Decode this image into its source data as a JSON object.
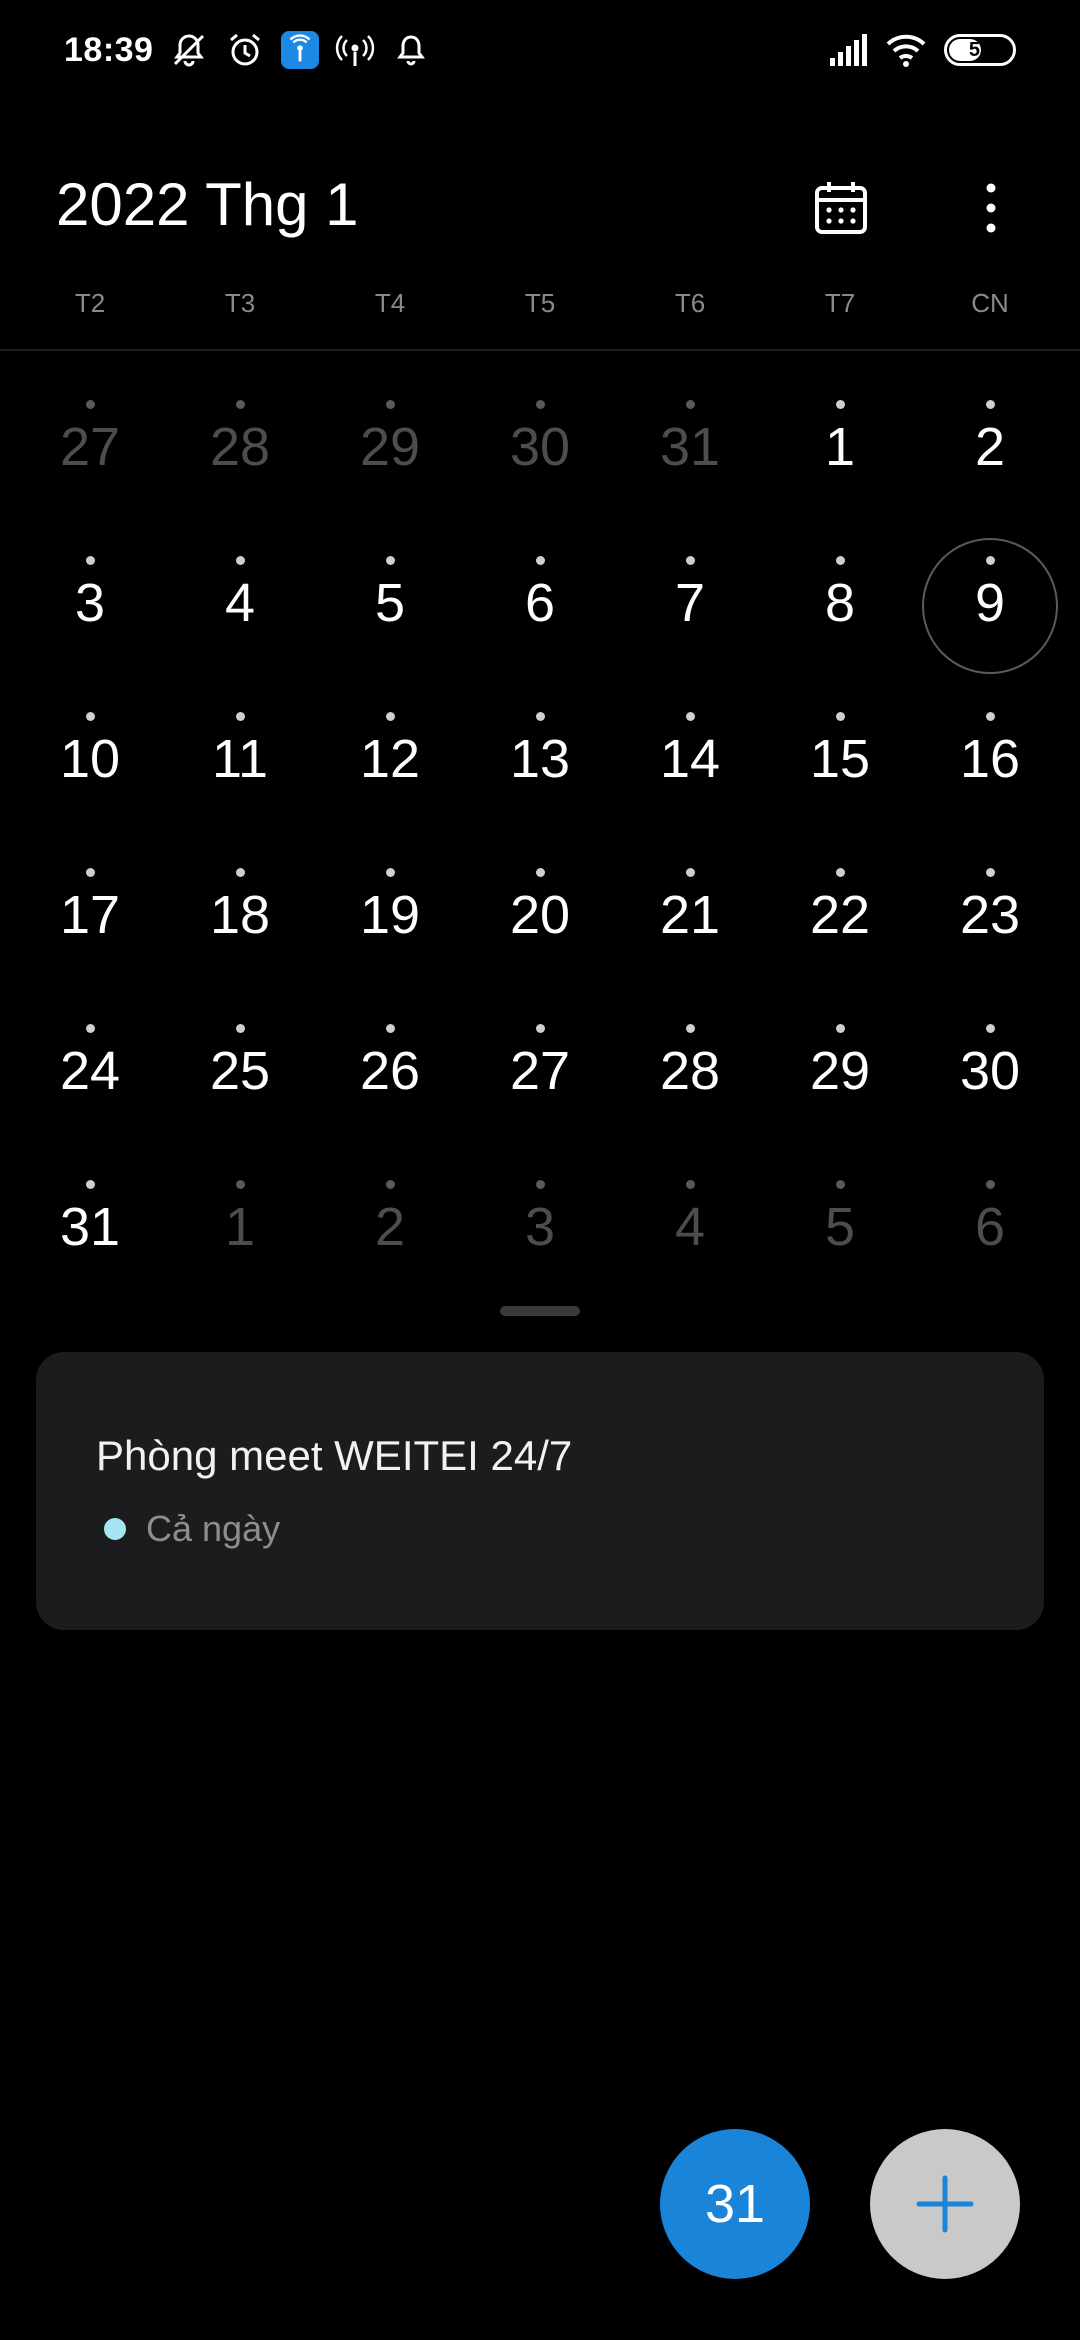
{
  "status_bar": {
    "time": "18:39",
    "battery": "55",
    "battery_level_percent": 55
  },
  "header": {
    "title": "2022 Thg 1",
    "calendar_icon": "calendar-icon",
    "more_icon": "more-vertical-icon"
  },
  "weekdays": [
    "T2",
    "T3",
    "T4",
    "T5",
    "T6",
    "T7",
    "CN"
  ],
  "month_grid": {
    "weeks": [
      [
        {
          "d": "27",
          "muted": true
        },
        {
          "d": "28",
          "muted": true
        },
        {
          "d": "29",
          "muted": true
        },
        {
          "d": "30",
          "muted": true
        },
        {
          "d": "31",
          "muted": true
        },
        {
          "d": "1"
        },
        {
          "d": "2"
        }
      ],
      [
        {
          "d": "3"
        },
        {
          "d": "4"
        },
        {
          "d": "5"
        },
        {
          "d": "6"
        },
        {
          "d": "7"
        },
        {
          "d": "8"
        },
        {
          "d": "9",
          "today": true
        }
      ],
      [
        {
          "d": "10"
        },
        {
          "d": "11"
        },
        {
          "d": "12"
        },
        {
          "d": "13"
        },
        {
          "d": "14"
        },
        {
          "d": "15"
        },
        {
          "d": "16"
        }
      ],
      [
        {
          "d": "17"
        },
        {
          "d": "18"
        },
        {
          "d": "19"
        },
        {
          "d": "20"
        },
        {
          "d": "21"
        },
        {
          "d": "22"
        },
        {
          "d": "23"
        }
      ],
      [
        {
          "d": "24"
        },
        {
          "d": "25"
        },
        {
          "d": "26"
        },
        {
          "d": "27"
        },
        {
          "d": "28"
        },
        {
          "d": "29"
        },
        {
          "d": "30"
        }
      ],
      [
        {
          "d": "31"
        },
        {
          "d": "1",
          "muted": true
        },
        {
          "d": "2",
          "muted": true
        },
        {
          "d": "3",
          "muted": true
        },
        {
          "d": "4",
          "muted": true
        },
        {
          "d": "5",
          "muted": true
        },
        {
          "d": "6",
          "muted": true
        }
      ]
    ]
  },
  "event": {
    "title": "Phòng meet WEITEI 24/7",
    "time": "Cả ngày",
    "color": "#a5e4f2"
  },
  "fab": {
    "today_label": "31",
    "today_color": "#1a84d9",
    "add_icon": "plus-icon",
    "add_color": "#c9c9c9"
  }
}
